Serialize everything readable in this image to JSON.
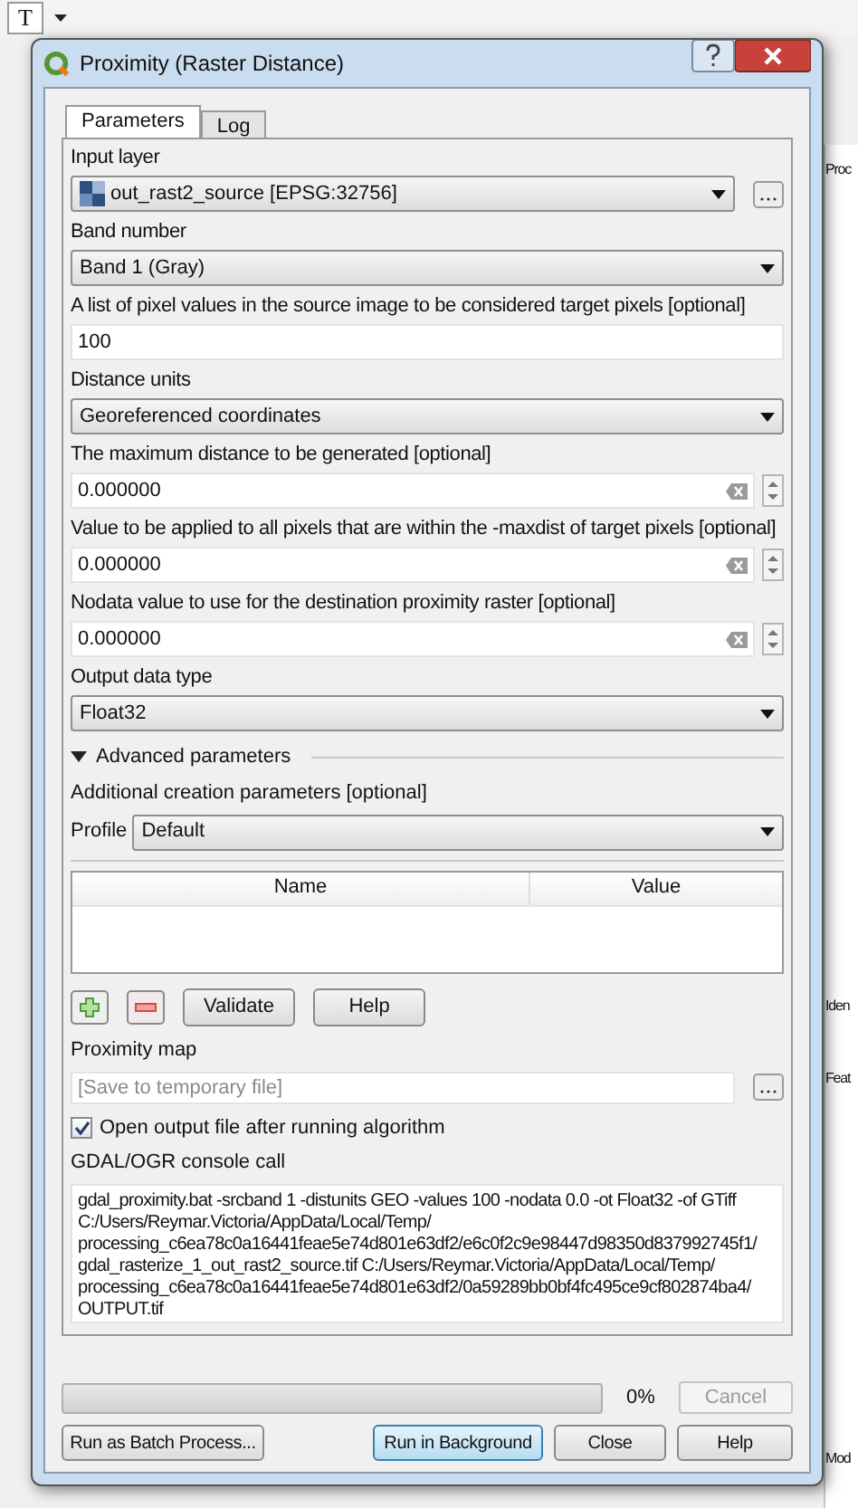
{
  "background": {
    "toolbar_glyph": "T",
    "panel_texts": [
      "Proc",
      "Iden",
      "Feat",
      "Mod"
    ]
  },
  "window": {
    "title": "Proximity (Raster Distance)"
  },
  "tabs": [
    {
      "label": "Parameters",
      "selected": true
    },
    {
      "label": "Log",
      "selected": false
    }
  ],
  "params": [
    {
      "kind": "layer",
      "label": "Input layer",
      "value": "out_rast2_source [EPSG:32756]"
    },
    {
      "kind": "combo",
      "label": "Band number",
      "value": "Band 1 (Gray)"
    },
    {
      "kind": "text",
      "label": "A list of pixel values in the source image to be considered target pixels [optional]",
      "value": "100"
    },
    {
      "kind": "combo",
      "label": "Distance units",
      "value": "Georeferenced coordinates"
    },
    {
      "kind": "number",
      "label": "The maximum distance to be generated [optional]",
      "value": "0.000000"
    },
    {
      "kind": "number",
      "label": "Value to be applied to all pixels that are within the -maxdist of target pixels [optional]",
      "value": "0.000000"
    },
    {
      "kind": "number",
      "label": "Nodata value to use for the destination proximity raster [optional]",
      "value": "0.000000"
    },
    {
      "kind": "combo",
      "label": "Output data type",
      "value": "Float32"
    }
  ],
  "advanced": {
    "label": "Advanced parameters",
    "expanded": true,
    "creation_label": "Additional creation parameters [optional]",
    "profile_label": "Profile",
    "profile": "Default",
    "columns": [
      "Name",
      "Value"
    ],
    "buttons": [
      "Validate",
      "Help"
    ]
  },
  "output": {
    "label": "Proximity map",
    "placeholder": "[Save to temporary file]",
    "open_after": {
      "label": "Open output file after running algorithm",
      "checked": true
    }
  },
  "console": {
    "label": "GDAL/OGR console call",
    "lines": [
      "gdal_proximity.bat -srcband 1 -distunits GEO -values 100 -nodata 0.0 -ot Float32 -of GTiff",
      "C:/Users/Reymar.Victoria/AppData/Local/Temp/",
      "processing_c6ea78c0a16441feae5e74d801e63df2/e6c0f2c9e98447d98350d837992745f1/",
      "gdal_rasterize_1_out_rast2_source.tif C:/Users/Reymar.Victoria/AppData/Local/Temp/",
      "processing_c6ea78c0a16441feae5e74d801e63df2/0a59289bb0bf4fc495ce9cf802874ba4/",
      "OUTPUT.tif"
    ]
  },
  "progress": {
    "level": 0,
    "reading": "0%",
    "cancel": {
      "label": "Cancel",
      "disabled": true
    }
  },
  "footer_buttons": [
    {
      "label": "Run as Batch Process...",
      "default": false
    },
    {
      "label": "Run in Background",
      "default": true
    },
    {
      "label": "Close",
      "default": false
    },
    {
      "label": "Help",
      "default": false
    }
  ]
}
